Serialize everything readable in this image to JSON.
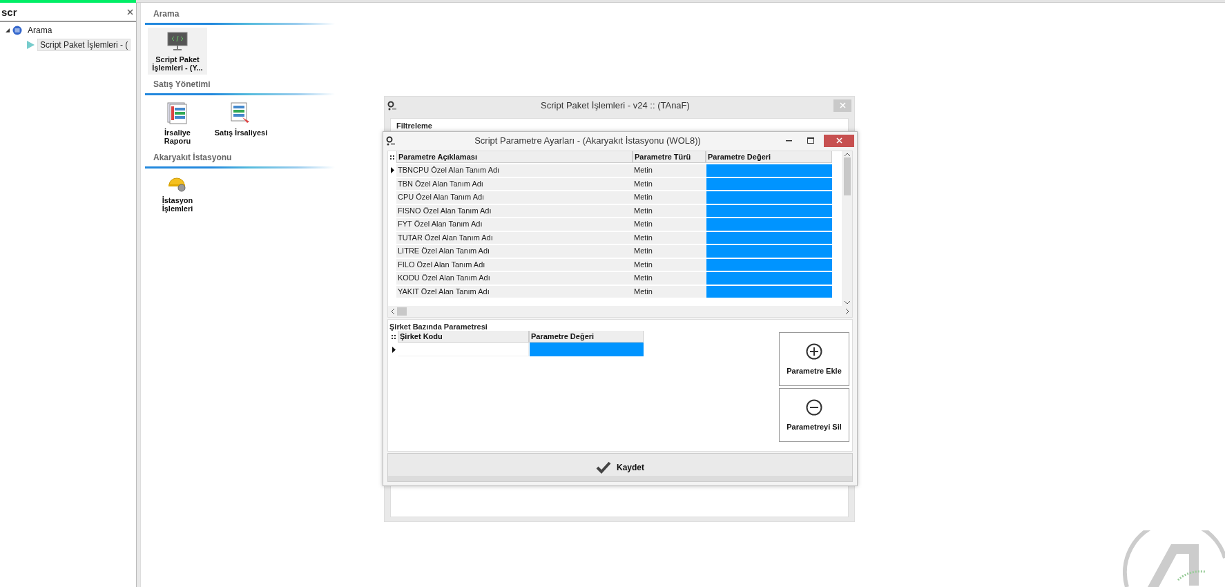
{
  "search_panel": {
    "query": "scr",
    "tree": [
      {
        "label": "Arama",
        "expanded": true,
        "selected": false,
        "children": [
          {
            "label": "Script Paket İşlemleri - (",
            "selected": true
          }
        ]
      }
    ]
  },
  "menu_sections": [
    {
      "title": "Arama",
      "tiles": [
        {
          "label": "Script Paket\nİşlemleri - (Y...",
          "kind": "code",
          "selected": true
        }
      ]
    },
    {
      "title": "Satış Yönetimi",
      "tiles": [
        {
          "label": "İrsaliye\nRaporu",
          "kind": "report",
          "selected": false
        },
        {
          "label": "Satış İrsaliyesi",
          "kind": "invoice",
          "selected": false
        }
      ]
    },
    {
      "title": "Akaryakıt İstasyonu",
      "tiles": [
        {
          "label": "İstasyon\nİşlemleri",
          "kind": "station",
          "selected": false
        }
      ]
    }
  ],
  "background_window": {
    "title": "Script Paket İşlemleri - v24 :: (TAnaF)",
    "filter_group": "Filtreleme"
  },
  "dialog": {
    "title": "Script Parametre Ayarları - (Akaryakıt İstasyonu (WOL8))",
    "grid": {
      "columns": [
        "Parametre Açıklaması",
        "Parametre Türü",
        "Parametre Değeri"
      ],
      "rows": [
        {
          "description": "TBNCPU Özel Alan Tanım Adı",
          "type": "Metin",
          "current": true
        },
        {
          "description": "TBN Özel Alan Tanım Adı",
          "type": "Metin",
          "current": false
        },
        {
          "description": "CPU Özel Alan Tanım Adı",
          "type": "Metin",
          "current": false
        },
        {
          "description": "FISNO Özel Alan Tanım Adı",
          "type": "Metin",
          "current": false
        },
        {
          "description": "FYT Özel Alan Tanım Adı",
          "type": "Metin",
          "current": false
        },
        {
          "description": "TUTAR Özel Alan Tanım Adı",
          "type": "Metin",
          "current": false
        },
        {
          "description": "LITRE Özel Alan Tanım Adı",
          "type": "Metin",
          "current": false
        },
        {
          "description": "FILO Özel Alan Tanım Adı",
          "type": "Metin",
          "current": false
        },
        {
          "description": "KODU Özel Alan Tanım Adı",
          "type": "Metin",
          "current": false
        },
        {
          "description": "YAKIT Özel Alan Tanım Adı",
          "type": "Metin",
          "current": false
        }
      ]
    },
    "company_group": {
      "title": "Şirket Bazında Parametresi",
      "columns": [
        "Şirket Kodu",
        "Parametre Değeri"
      ],
      "rows": [
        {
          "current": true
        }
      ]
    },
    "side_buttons": [
      {
        "label": "Parametre Ekle",
        "kind": "add"
      },
      {
        "label": "Parametreyi Sil",
        "kind": "remove"
      }
    ],
    "save_button": "Kaydet"
  }
}
